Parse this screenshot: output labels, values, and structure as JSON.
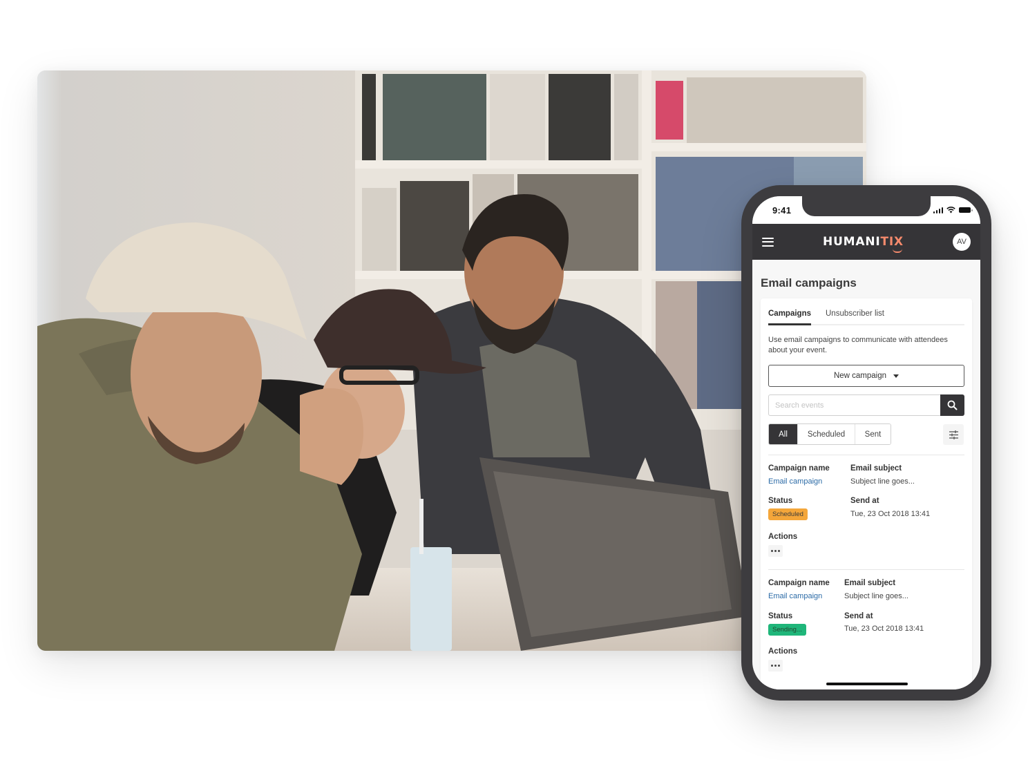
{
  "photo": {
    "description": "Three men laughing while looking at a laptop in front of a bookshelf",
    "colors": {
      "wall": "#d8d3cc",
      "shelf": "#e9e4dc",
      "jacket_olive": "#7b7559",
      "cap_light": "#e5dccd",
      "cap_dark": "#3e2f2c",
      "hoodie_dark": "#3b3b3f",
      "binders_blue": "#6d7d99",
      "laptop": "#575350"
    }
  },
  "phone": {
    "status_bar": {
      "time": "9:41"
    },
    "app_bar": {
      "menu_icon": "hamburger-icon",
      "logo_main": "HUMANI",
      "logo_accent": "TIX",
      "avatar_initials": "AV"
    },
    "page_title": "Email campaigns",
    "tabs": [
      {
        "label": "Campaigns",
        "active": true
      },
      {
        "label": "Unsubscriber list",
        "active": false
      }
    ],
    "description": "Use email campaigns to communicate with attendees about your event.",
    "new_campaign_label": "New campaign",
    "search": {
      "placeholder": "Search events",
      "value": ""
    },
    "filters": [
      {
        "label": "All",
        "active": true
      },
      {
        "label": "Scheduled",
        "active": false
      },
      {
        "label": "Sent",
        "active": false
      }
    ],
    "labels": {
      "campaign_name": "Campaign name",
      "email_subject": "Email subject",
      "status": "Status",
      "send_at": "Send at",
      "actions": "Actions"
    },
    "campaigns": [
      {
        "name": "Email campaign",
        "subject": "Subject line goes...",
        "status": "Scheduled",
        "send_at": "Tue, 23 Oct 2018 13:41"
      },
      {
        "name": "Email campaign",
        "subject": "Subject line goes...",
        "status": "Sending...",
        "send_at": "Tue, 23 Oct 2018 13:41"
      }
    ],
    "colors": {
      "app_bar": "#353437",
      "accent": "#f58a6c",
      "link": "#2a6aa6",
      "scheduled_badge": "#f4a63a",
      "sending_badge": "#1fb67a"
    }
  }
}
